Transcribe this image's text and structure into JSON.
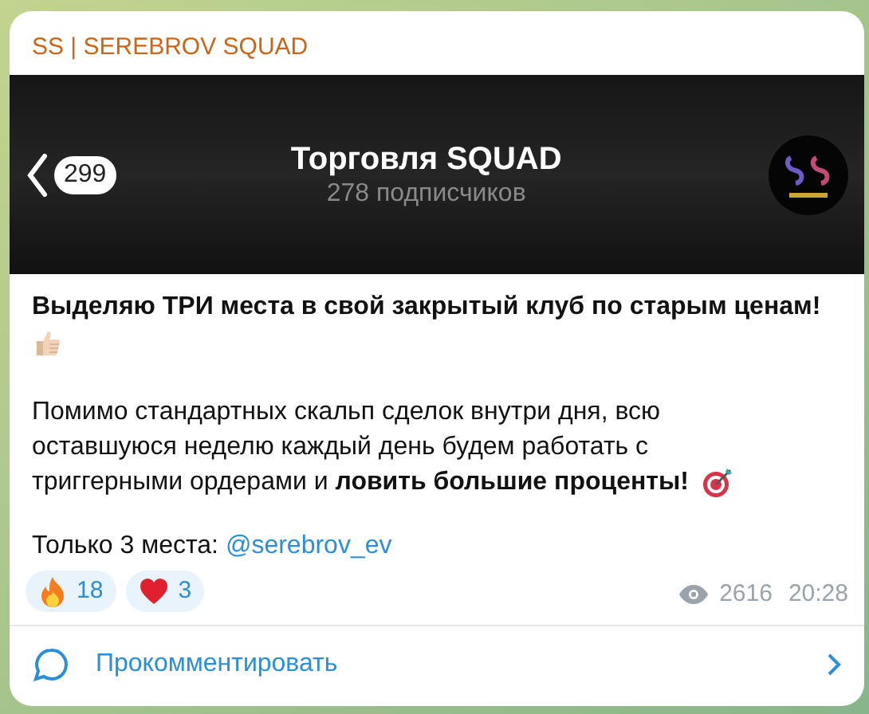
{
  "post": {
    "channel": "SS | SEREBROV SQUAD",
    "screenshot": {
      "back_count": "299",
      "title": "Торговля SQUAD",
      "subtitle": "278 подписчиков"
    },
    "paragraphs": [
      {
        "text": "Выделяю ТРИ места в свой закрытый клуб по старым ценам!",
        "bold": true,
        "emoji": {
          "kind": "thumbs-up",
          "own_line": true
        }
      },
      {
        "text": "Помимо стандартных скальп сделок внутри дня, всю оставшуюся неделю каждый день будем работать с триггерными ордерами и **ловить большие проценты!**",
        "bold": false,
        "emoji": {
          "kind": "target",
          "own_line": false
        }
      }
    ],
    "contact": {
      "label": "Только 3 места:",
      "link": "@serebrov_ev"
    },
    "reactions": [
      {
        "kind": "fire",
        "count": "18"
      },
      {
        "kind": "heart",
        "count": "3"
      }
    ],
    "views": "2616",
    "time": "20:28"
  },
  "comment_button": "Прокомментировать"
}
